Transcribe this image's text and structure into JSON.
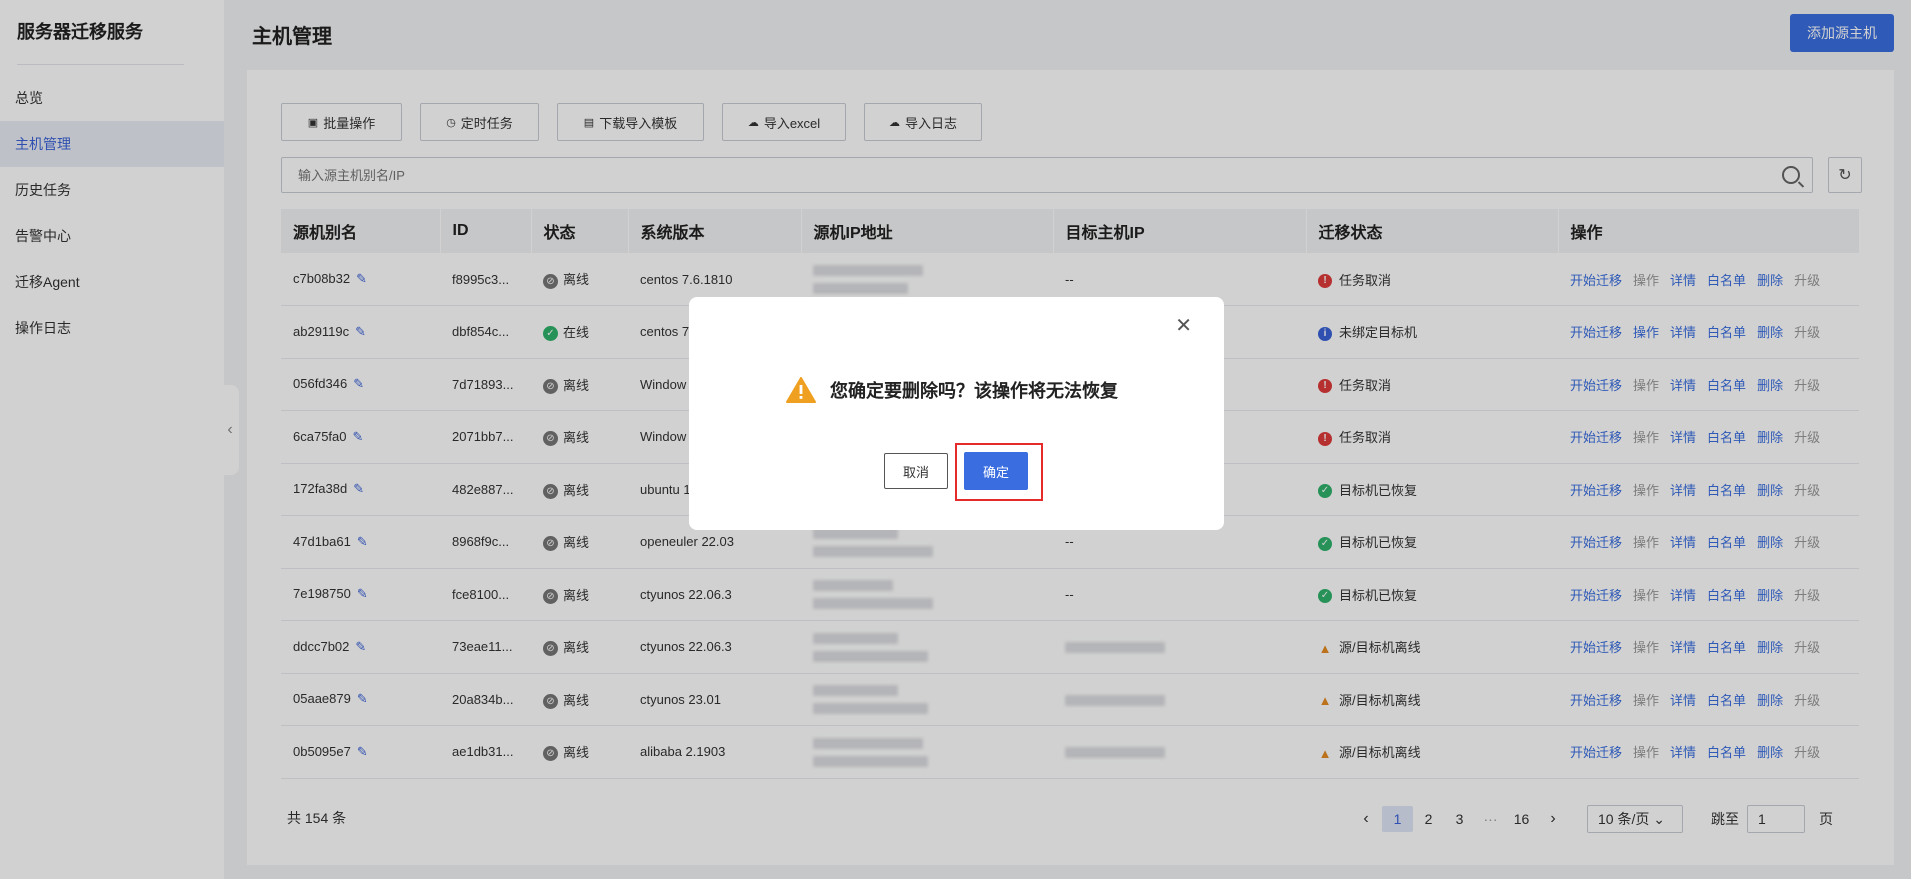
{
  "sidebar": {
    "brand": "服务器迁移服务",
    "items": [
      {
        "label": "总览"
      },
      {
        "label": "主机管理"
      },
      {
        "label": "历史任务"
      },
      {
        "label": "告警中心"
      },
      {
        "label": "迁移Agent"
      },
      {
        "label": "操作日志"
      }
    ],
    "active_index": 1
  },
  "header": {
    "title": "主机管理",
    "add_button": "添加源主机"
  },
  "toolbar": {
    "batch": "批量操作",
    "schedule": "定时任务",
    "download_template": "下载导入模板",
    "import_excel": "导入excel",
    "import_log": "导入日志"
  },
  "search": {
    "placeholder": "输入源主机别名/IP"
  },
  "table": {
    "columns": [
      "源机别名",
      "ID",
      "状态",
      "系统版本",
      "源机IP地址",
      "目标主机IP",
      "迁移状态",
      "操作"
    ],
    "actions": [
      "开始迁移",
      "操作",
      "详情",
      "白名单",
      "删除",
      "升级"
    ],
    "rows": [
      {
        "alias": "c7b08b32",
        "id": "f8995c3...",
        "status": "离线",
        "os": "centos 7.6.1810",
        "target": "--",
        "migration": "任务取消",
        "migration_icon": "error-icon"
      },
      {
        "alias": "ab29119c",
        "id": "dbf854c...",
        "status": "在线",
        "os": "centos 7",
        "target": "",
        "migration": "未绑定目标机",
        "migration_icon": "info-icon"
      },
      {
        "alias": "056fd346",
        "id": "7d71893...",
        "status": "离线",
        "os": "Window 2 6.1.76",
        "target": "",
        "migration": "任务取消",
        "migration_icon": "error-icon"
      },
      {
        "alias": "6ca75fa0",
        "id": "2071bb7...",
        "status": "离线",
        "os": "Window 2 6.3.96",
        "target": "",
        "migration": "任务取消",
        "migration_icon": "error-icon"
      },
      {
        "alias": "172fa38d",
        "id": "482e887...",
        "status": "离线",
        "os": "ubuntu 1",
        "target": "",
        "migration": "目标机已恢复",
        "migration_icon": "success-icon"
      },
      {
        "alias": "47d1ba61",
        "id": "8968f9c...",
        "status": "离线",
        "os": "openeuler 22.03",
        "target": "--",
        "migration": "目标机已恢复",
        "migration_icon": "success-icon"
      },
      {
        "alias": "7e198750",
        "id": "fce8100...",
        "status": "离线",
        "os": "ctyunos 22.06.3",
        "target": "--",
        "migration": "目标机已恢复",
        "migration_icon": "success-icon"
      },
      {
        "alias": "ddcc7b02",
        "id": "73eae11...",
        "status": "离线",
        "os": "ctyunos 22.06.3",
        "target": "",
        "migration": "源/目标机离线",
        "migration_icon": "warning-icon"
      },
      {
        "alias": "05aae879",
        "id": "20a834b...",
        "status": "离线",
        "os": "ctyunos 23.01",
        "target": "",
        "migration": "源/目标机离线",
        "migration_icon": "warning-icon"
      },
      {
        "alias": "0b5095e7",
        "id": "ae1db31...",
        "status": "离线",
        "os": "alibaba 2.1903",
        "target": "",
        "migration": "源/目标机离线",
        "migration_icon": "warning-icon"
      }
    ]
  },
  "pagination": {
    "total": "共 154 条",
    "pages": [
      "1",
      "2",
      "3",
      "···",
      "16"
    ],
    "current": "1",
    "page_size": "10 条/页",
    "jump_label": "跳至",
    "jump_value": "1",
    "jump_unit": "页"
  },
  "dialog": {
    "message": "您确定要删除吗？该操作将无法恢复",
    "cancel": "取消",
    "confirm": "确定"
  },
  "colors": {
    "primary": "#3a6ee0",
    "error": "#e03b3b",
    "success": "#2fb36b",
    "warning": "#e58b22",
    "highlight_frame": "#e62a2a"
  }
}
